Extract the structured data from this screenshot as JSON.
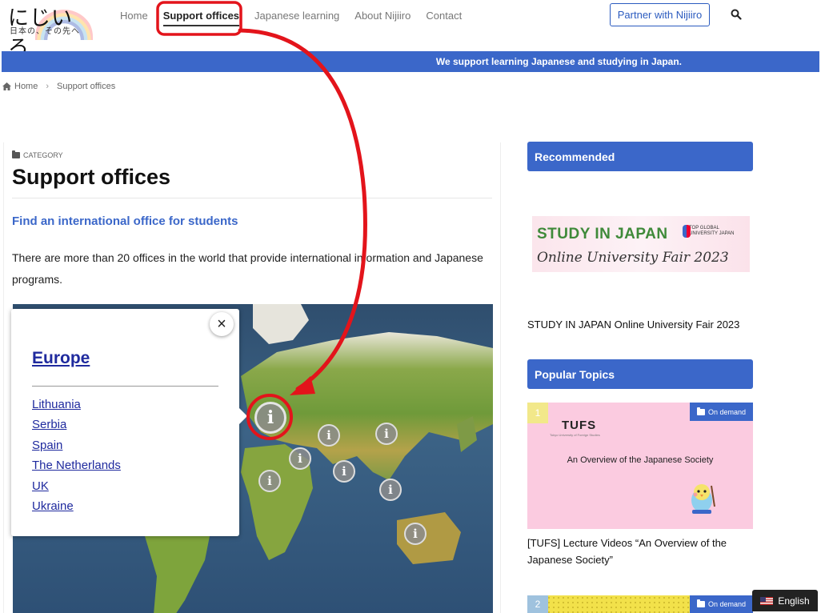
{
  "header": {
    "logo_main": "にじいろ",
    "logo_sub": "日本の、その先へ",
    "nav": [
      "Home",
      "Support offices",
      "Japanese learning",
      "About Nijiiro",
      "Contact"
    ],
    "active_nav": "Support offices",
    "partner_label": "Partner with Nijiiro"
  },
  "banner": "We support learning Japanese and studying in Japan.",
  "breadcrumb": {
    "home": "Home",
    "current": "Support offices"
  },
  "main": {
    "category_label": "CATEGORY",
    "title": "Support offices",
    "subtitle": "Find an international office for students",
    "intro": "There are more than 20 offices in the world that provide international information and Japanese programs."
  },
  "map": {
    "pin_glyph": "i",
    "popup": {
      "title": "Europe",
      "items": [
        "Lithuania",
        "Serbia",
        "Spain",
        "The Netherlands",
        "UK",
        "Ukraine"
      ],
      "close_glyph": "×"
    }
  },
  "sidebar": {
    "recommended_heading": "Recommended",
    "fair_banner_main": "STUDY IN JAPAN",
    "fair_banner_sub": "Online University Fair 2023",
    "fair_badge": "TOP GLOBAL UNIVERSITY JAPAN",
    "fair_caption": "STUDY IN JAPAN Online University Fair 2023",
    "popular_heading": "Popular Topics",
    "topics": [
      {
        "rank": "1",
        "badge": "On demand",
        "image_logo": "TUFS",
        "image_logo_sub": "Tokyo University of Foreign Studies",
        "image_text": "An Overview of the Japanese Society",
        "caption": "[TUFS] Lecture Videos “An Overview of the Japanese Society”"
      },
      {
        "rank": "2",
        "badge": "On demand"
      }
    ]
  },
  "language": "English",
  "colors": {
    "accent": "#3b67c9",
    "annotation": "#e3141b",
    "link": "#1f2a9e"
  }
}
